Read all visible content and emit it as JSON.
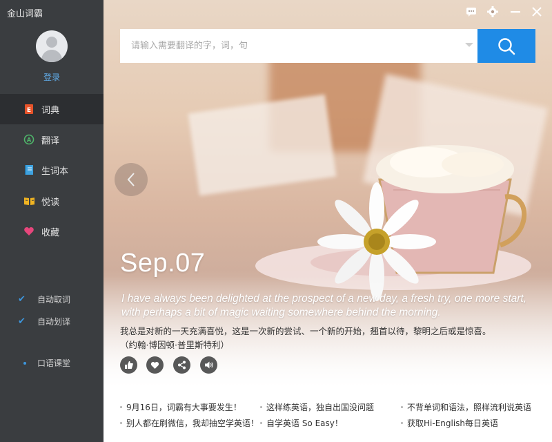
{
  "app": {
    "title": "金山词霸"
  },
  "user": {
    "login_label": "登录"
  },
  "nav": [
    {
      "label": "词典",
      "icon": "dictionary-icon",
      "color": "#e6532a",
      "active": true
    },
    {
      "label": "翻译",
      "icon": "translate-icon",
      "color": "#4fb56a",
      "active": false
    },
    {
      "label": "生词本",
      "icon": "wordbook-icon",
      "color": "#3fa3e0",
      "active": false
    },
    {
      "label": "悦读",
      "icon": "reading-icon",
      "color": "#f0b422",
      "active": false
    },
    {
      "label": "收藏",
      "icon": "heart-icon",
      "color": "#e7467c",
      "active": false
    }
  ],
  "options": [
    {
      "label": "自动取词",
      "checked": true
    },
    {
      "label": "自动划译",
      "checked": true
    }
  ],
  "oral_class": {
    "label": "口语课堂"
  },
  "search": {
    "placeholder": "请输入需要翻译的字，词，句"
  },
  "daily": {
    "date": "Sep.07",
    "quote_en": "I have always been delighted at the prospect of a new day, a fresh try, one more start, with perhaps a bit of magic waiting somewhere behind the morning.",
    "quote_cn": "我总是对新的一天充满喜悦，这是一次新的尝试、一个新的开始，翘首以待，黎明之后或是惊喜。",
    "author": "（约翰·博因顿·普里斯特利）"
  },
  "footer": {
    "links": [
      "9月16日，词霸有大事要发生！",
      "这样练英语，独自出国没问题",
      "不背单词和语法，照样流利说英语",
      "别人都在刷微信，我却抽空学英语！",
      "自学英语 So Easy！",
      "获取Hi-English每日英语"
    ]
  },
  "colors": {
    "accent": "#1f8be6",
    "sidebar": "#3a3d40",
    "sidebar_active": "#2c2e31"
  }
}
